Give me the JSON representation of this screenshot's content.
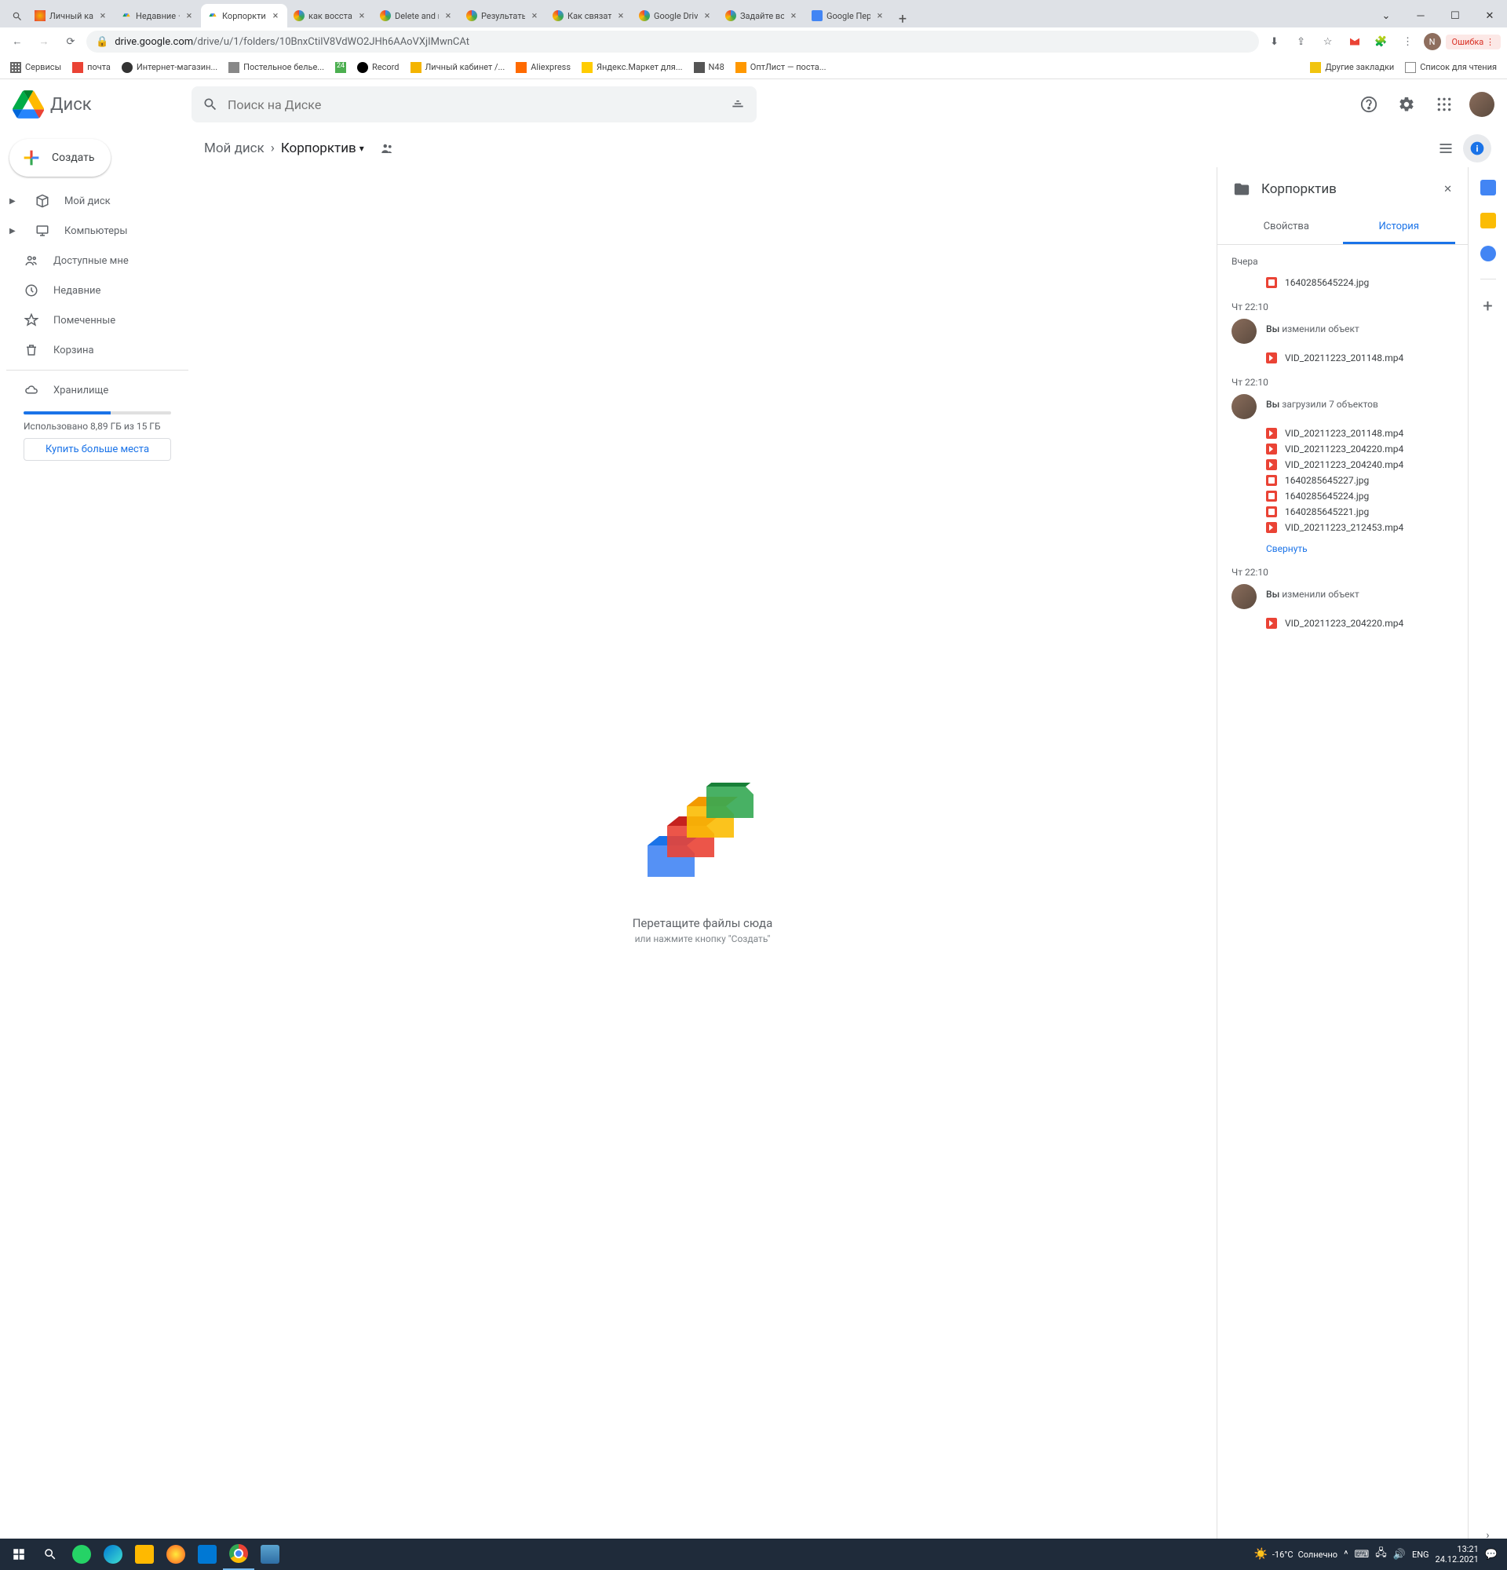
{
  "browser": {
    "tabs": [
      {
        "title": "Личный кабинет"
      },
      {
        "title": "Недавние – Goo"
      },
      {
        "title": "Корпорктив – G",
        "active": true
      },
      {
        "title": "как восстановит"
      },
      {
        "title": "Delete and resto"
      },
      {
        "title": "Результаты поис"
      },
      {
        "title": "Как связаться со"
      },
      {
        "title": "Google Drive Co"
      },
      {
        "title": "Задайте вопрос"
      },
      {
        "title": "Google Перевод"
      }
    ],
    "url_host": "drive.google.com",
    "url_path": "/drive/u/1/folders/10BnxCtiIV8VdWO2JHh6AAoVXjIMwnCAt",
    "error_badge": "Ошибка",
    "bookmarks": [
      "Сервисы",
      "почта",
      "Интернет-магазин...",
      "Постельное белье...",
      "24",
      "Record",
      "Личный кабинет /...",
      "Aliexpress",
      "Яндекс.Маркет для...",
      "N48",
      "ОптЛист — поста..."
    ],
    "bk_right1": "Другие закладки",
    "bk_right2": "Список для чтения"
  },
  "drive": {
    "logo": "Диск",
    "search_placeholder": "Поиск на Диске",
    "create": "Создать",
    "nav": {
      "mydrive": "Мой диск",
      "computers": "Компьютеры",
      "shared": "Доступные мне",
      "recent": "Недавние",
      "starred": "Помеченные",
      "trash": "Корзина",
      "storage": "Хранилище"
    },
    "storage_text": "Использовано 8,89 ГБ из 15 ГБ",
    "buy": "Купить больше места",
    "breadcrumb": {
      "root": "Мой диск",
      "current": "Корпорктив"
    },
    "empty": {
      "title": "Перетащите файлы сюда",
      "sub": "или нажмите кнопку \"Создать\""
    }
  },
  "details": {
    "title": "Корпорктив",
    "tab_props": "Свойства",
    "tab_history": "История",
    "yesterday": "Вчера",
    "file0": "1640285645224.jpg",
    "t1": "Чт 22:10",
    "you": "Вы",
    "changed": "изменили объект",
    "f1": "VID_20211223_201148.mp4",
    "uploaded": "загрузили 7 объектов",
    "files2": [
      "VID_20211223_201148.mp4",
      "VID_20211223_204220.mp4",
      "VID_20211223_204240.mp4",
      "1640285645227.jpg",
      "1640285645224.jpg",
      "1640285645221.jpg",
      "VID_20211223_212453.mp4"
    ],
    "collapse": "Свернуть",
    "f3": "VID_20211223_204220.mp4"
  },
  "taskbar": {
    "temp": "-16°C",
    "weather": "Солнечно",
    "lang": "ENG",
    "time": "13:21",
    "date": "24.12.2021"
  }
}
